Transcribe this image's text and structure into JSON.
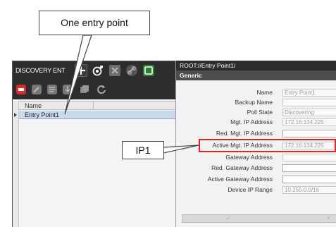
{
  "left_panel": {
    "title": "DISCOVERY ENT",
    "list": {
      "column_name": "Name",
      "rows": [
        "Entry Point1"
      ]
    }
  },
  "right_panel": {
    "path": "ROOT://Entry Point1/",
    "section": "Generic",
    "properties": [
      {
        "label": "Name",
        "value": "Entry Point1"
      },
      {
        "label": "Backup Name",
        "value": ""
      },
      {
        "label": "Poll State",
        "value": "Discovering"
      },
      {
        "label": "Mgt. IP Address",
        "value": "172.16.134.225"
      },
      {
        "label": "Red. Mgt. IP Address",
        "value": ""
      },
      {
        "label": "Active Mgt. IP Address",
        "value": "172.16.134.225"
      },
      {
        "label": "Gateway Address",
        "value": ""
      },
      {
        "label": "Red. Gateway Address",
        "value": ""
      },
      {
        "label": "Active Gateway Address",
        "value": ""
      },
      {
        "label": "Device IP Range",
        "value": "10.255.0.0/16"
      }
    ],
    "bottom_bar": {
      "check": "✓",
      "cross": "×"
    }
  },
  "callouts": {
    "entry_point": "One entry point",
    "ip": "IP1"
  },
  "colors": {
    "panel_header": "#2d2d2d",
    "highlight": "#e0242a",
    "selected_row": "#c9d9ee"
  }
}
